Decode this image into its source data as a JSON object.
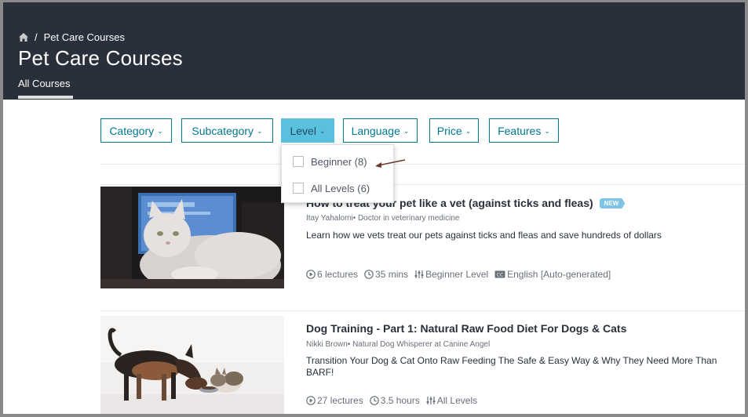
{
  "breadcrumb": {
    "home_icon": "home-icon",
    "separator": "/",
    "current": "Pet Care Courses"
  },
  "page": {
    "title": "Pet Care Courses",
    "tab": "All Courses"
  },
  "filters": [
    {
      "label": "Category",
      "active": false
    },
    {
      "label": "Subcategory",
      "active": false
    },
    {
      "label": "Level",
      "active": true
    },
    {
      "label": "Language",
      "active": false
    },
    {
      "label": "Price",
      "active": false
    },
    {
      "label": "Features",
      "active": false
    }
  ],
  "level_dropdown": {
    "options": [
      "Beginner (8)",
      "All Levels (6)"
    ]
  },
  "courses": [
    {
      "title": "How to treat your pet like a vet (against ticks and fleas)",
      "badge": "NEW",
      "instructor": "Itay Yahalomi• Doctor in veterinary medicine",
      "description": "Learn how we vets treat our pets against ticks and fleas and save hundreds of dollars",
      "lectures": "6 lectures",
      "duration": "35 mins",
      "level": "Beginner Level",
      "captions": "English [Auto-generated]"
    },
    {
      "title": "Dog Training - Part 1: Natural Raw Food Diet For Dogs & Cats",
      "instructor": "Nikki Brown• Natural Dog Whisperer at Canine Angel",
      "description": "Transition Your Dog & Cat Onto Raw Feeding The Safe & Easy Way & Why They Need More Than BARF!",
      "lectures": "27 lectures",
      "duration": "3.5 hours",
      "level": "All Levels"
    }
  ],
  "colors": {
    "header_bg": "#29303b",
    "accent": "#007791",
    "active_filter": "#5bc0de",
    "badge": "#7ec4e8",
    "annotation_arrow": "#6b3a2a"
  }
}
